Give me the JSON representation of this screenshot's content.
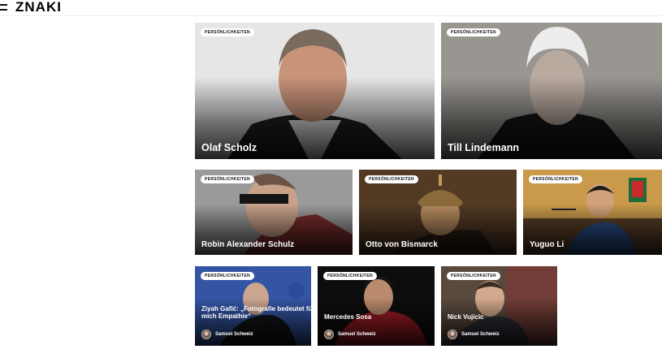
{
  "header": {
    "logo": "ZNAKI"
  },
  "badge_label": "PERSÖNLICHKEITEN",
  "cards_row1": [
    {
      "title": "Olaf Scholz"
    },
    {
      "title": "Till Lindemann"
    }
  ],
  "cards_row2": [
    {
      "title": "Robin Alexander Schulz"
    },
    {
      "title": "Otto von Bismarck"
    },
    {
      "title": "Yuguo Li"
    }
  ],
  "cards_row3": [
    {
      "title": "Ziyah Gafić: „Fotografie bedeutet für mich Empathie“",
      "author": "Samuel Schweiz"
    },
    {
      "title": "Mercedes Sosa",
      "author": "Samuel Schweiz"
    },
    {
      "title": "Nick Vujicic",
      "author": "Samuel Schweiz"
    }
  ],
  "colors": {
    "text_on_image": "#ffffff",
    "badge_bg": "#ffffff",
    "logo": "#000000"
  }
}
